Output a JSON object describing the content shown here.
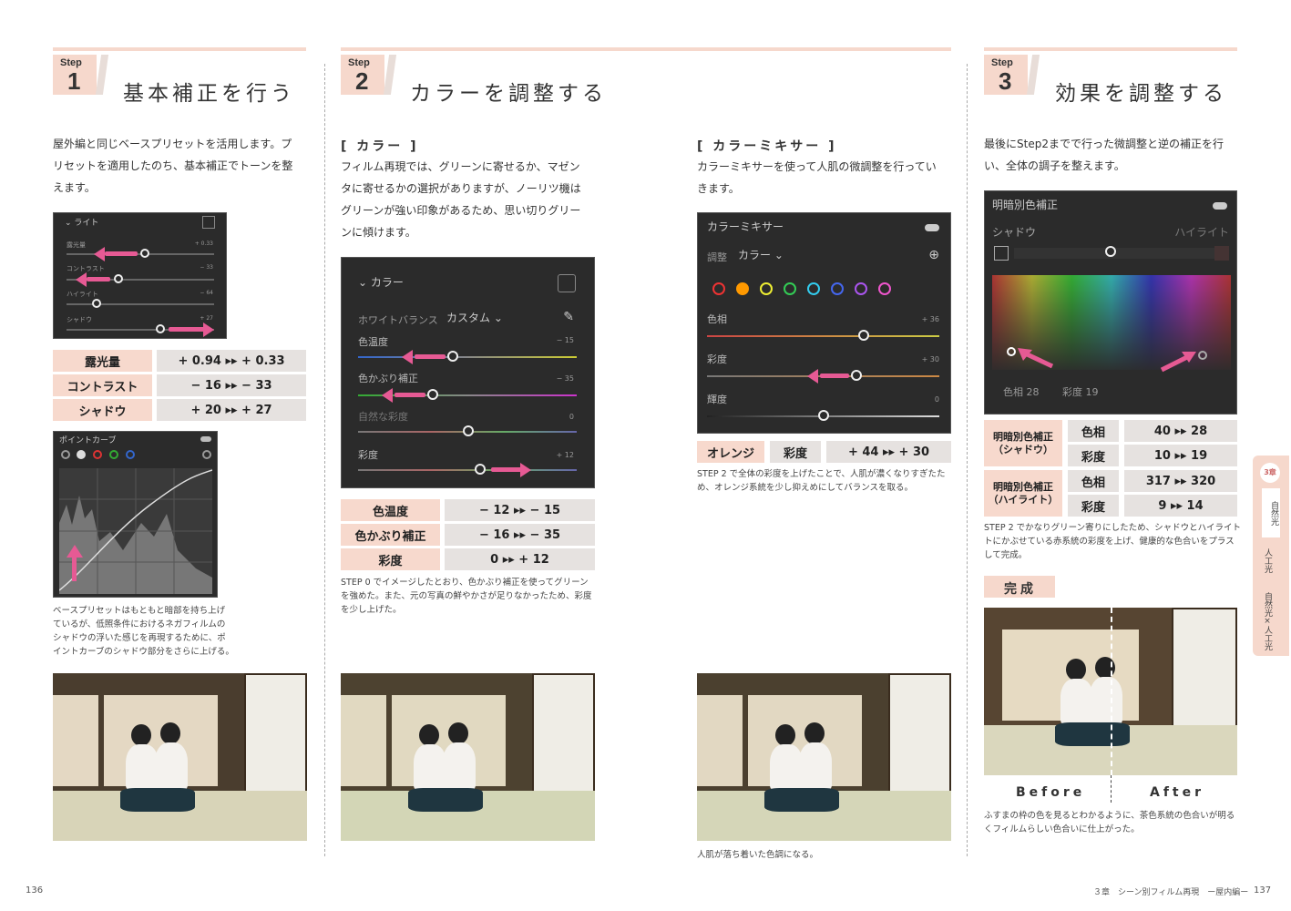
{
  "steps": [
    {
      "label": "Step",
      "num": "1",
      "title": "基本補正を行う"
    },
    {
      "label": "Step",
      "num": "2",
      "title": "カラーを調整する"
    },
    {
      "label": "Step",
      "num": "3",
      "title": "効果を調整する"
    }
  ],
  "col1": {
    "intro": [
      "屋外編と同じベースプリセットを活用します。プ",
      "リセットを適用したのち、基本補正でトーンを整",
      "えます。"
    ],
    "panel": {
      "header": "ライト",
      "sliders": [
        {
          "label": "露光量",
          "value": "+ 0.33"
        },
        {
          "label": "コントラスト",
          "value": "− 33"
        },
        {
          "label": "ハイライト",
          "value": "− 64"
        },
        {
          "label": "シャドウ",
          "value": "+ 27"
        }
      ]
    },
    "table": [
      {
        "k": "露光量",
        "v": "+ 0.94 ▸▸ + 0.33"
      },
      {
        "k": "コントラスト",
        "v": "− 16 ▸▸ − 33"
      },
      {
        "k": "シャドウ",
        "v": "+ 20 ▸▸ + 27"
      }
    ],
    "curve_header": "ポイントカーブ",
    "caption": [
      "ベースプリセットはもともと暗部を持ち上げ",
      "ているが、低照条件におけるネガフィルムの",
      "シャドウの浮いた感じを再現するために、ポ",
      "イントカーブのシャドウ部分をさらに上げる。"
    ]
  },
  "col2": {
    "sub": "[ カラー ]",
    "intro": [
      "フィルム再現では、グリーンに寄せるか、マゼン",
      "タに寄せるかの選択がありますが、ノーリツ機は",
      "グリーンが強い印象があるため、思い切りグリー",
      "ンに傾けます。"
    ],
    "panel": {
      "header": "カラー",
      "wb_label": "ホワイトバランス",
      "wb_value": "カスタム ⌄",
      "sliders": [
        {
          "label": "色温度",
          "value": "− 15"
        },
        {
          "label": "色かぶり補正",
          "value": "− 35"
        },
        {
          "label": "自然な彩度",
          "value": "0"
        },
        {
          "label": "彩度",
          "value": "+ 12"
        }
      ]
    },
    "table": [
      {
        "k": "色温度",
        "v": "− 12 ▸▸ − 15"
      },
      {
        "k": "色かぶり補正",
        "v": "− 16 ▸▸ − 35"
      },
      {
        "k": "彩度",
        "v": "0 ▸▸ + 12"
      }
    ],
    "caption": [
      "STEP 0 でイメージしたとおり、色かぶり補正を使ってグリーン",
      "を強めた。また、元の写真の鮮やかさが足りなかったため、彩度",
      "を少し上げた。"
    ]
  },
  "col3": {
    "sub": "[ カラーミキサー ]",
    "intro": [
      "カラーミキサーを使って人肌の微調整を行ってい",
      "きます。"
    ],
    "panel": {
      "header": "カラーミキサー",
      "adjust_label": "調整",
      "adjust_value": "カラー ⌄",
      "sliders": [
        {
          "label": "色相",
          "value": "+ 36"
        },
        {
          "label": "彩度",
          "value": "+ 30"
        },
        {
          "label": "輝度",
          "value": "0"
        }
      ]
    },
    "table": {
      "k1": "オレンジ",
      "k2": "彩度",
      "v": "+ 44 ▸▸ + 30"
    },
    "caption": [
      "STEP 2 で全体の彩度を上げたことで、人肌が濃くなりすぎたた",
      "め、オレンジ系統を少し抑えめにしてバランスを取る。"
    ],
    "photo_caption": "人肌が落ち着いた色調になる。"
  },
  "col4": {
    "intro": [
      "最後にStep2までで行った微調整と逆の補正を行",
      "い、全体の調子を整えます。"
    ],
    "panel": {
      "header": "明暗別色補正",
      "shadow": "シャドウ",
      "highlight": "ハイライト",
      "hue_label": "色相",
      "hue_val": "28",
      "sat_label": "彩度",
      "sat_val": "19"
    },
    "table": [
      {
        "group": "明暗別色補正\n（シャドウ）",
        "rows": [
          {
            "k": "色相",
            "v": "40 ▸▸ 28"
          },
          {
            "k": "彩度",
            "v": "10 ▸▸ 19"
          }
        ]
      },
      {
        "group": "明暗別色補正\n（ハイライト）",
        "rows": [
          {
            "k": "色相",
            "v": "317 ▸▸ 320"
          },
          {
            "k": "彩度",
            "v": "9 ▸▸ 14"
          }
        ]
      }
    ],
    "caption": [
      "STEP 2 でかなりグリーン寄りにしたため、シャドウとハイライト",
      "トにかぶせている赤系統の彩度を上げ、健康的な色合いをプラス",
      "して完成。"
    ],
    "done": "完成",
    "before": "Before",
    "after": "After",
    "photo_caption": [
      "ふすまの枠の色を見るとわかるように、茶色系統の色合いが明る",
      "くフィルムらしい色合いに仕上がった。"
    ]
  },
  "side_tab": {
    "chapter": "3章",
    "items": [
      "自然光",
      "人工光",
      "自然光×人工光"
    ]
  },
  "footer": {
    "left_page": "136",
    "right_page": "137",
    "running": "３章　シーン別フィルム再現　ー屋内編ー"
  }
}
